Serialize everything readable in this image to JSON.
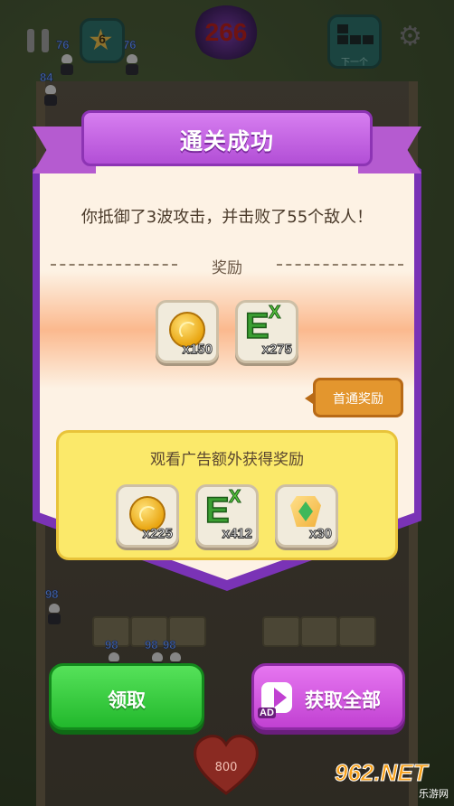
{
  "hud": {
    "level": "6",
    "score": "266",
    "next_label": "下一个"
  },
  "enemies": {
    "counts": [
      "76",
      "76",
      "84",
      "98",
      "98",
      "98",
      "98"
    ]
  },
  "dialog": {
    "title": "通关成功",
    "message": "你抵御了3波攻击，并击败了55个敌人！",
    "reward_label": "奖励",
    "rewards": [
      {
        "icon": "gold-coin-icon",
        "amount": "x150"
      },
      {
        "icon": "exp-icon",
        "amount": "x275"
      }
    ],
    "first_clear_tag": "首通奖励",
    "ad_section_title": "观看广告额外获得奖励",
    "ad_rewards": [
      {
        "icon": "gold-coin-icon",
        "amount": "x225"
      },
      {
        "icon": "exp-icon",
        "amount": "x412"
      },
      {
        "icon": "gem-shard-icon",
        "amount": "x30"
      }
    ]
  },
  "buttons": {
    "claim": "领取",
    "claim_all": "获取全部",
    "ad_badge": "AD"
  },
  "base": {
    "hp": "800"
  },
  "watermark": {
    "main": "962.NET",
    "sub": "乐游网"
  },
  "colors": {
    "ribbon": "#b24fd6",
    "panel": "#fdf2e4",
    "ad_box": "#fbe96a",
    "claim_button": "#22b82c",
    "claim_all_button": "#c141d2",
    "first_tag": "#e3962e"
  }
}
